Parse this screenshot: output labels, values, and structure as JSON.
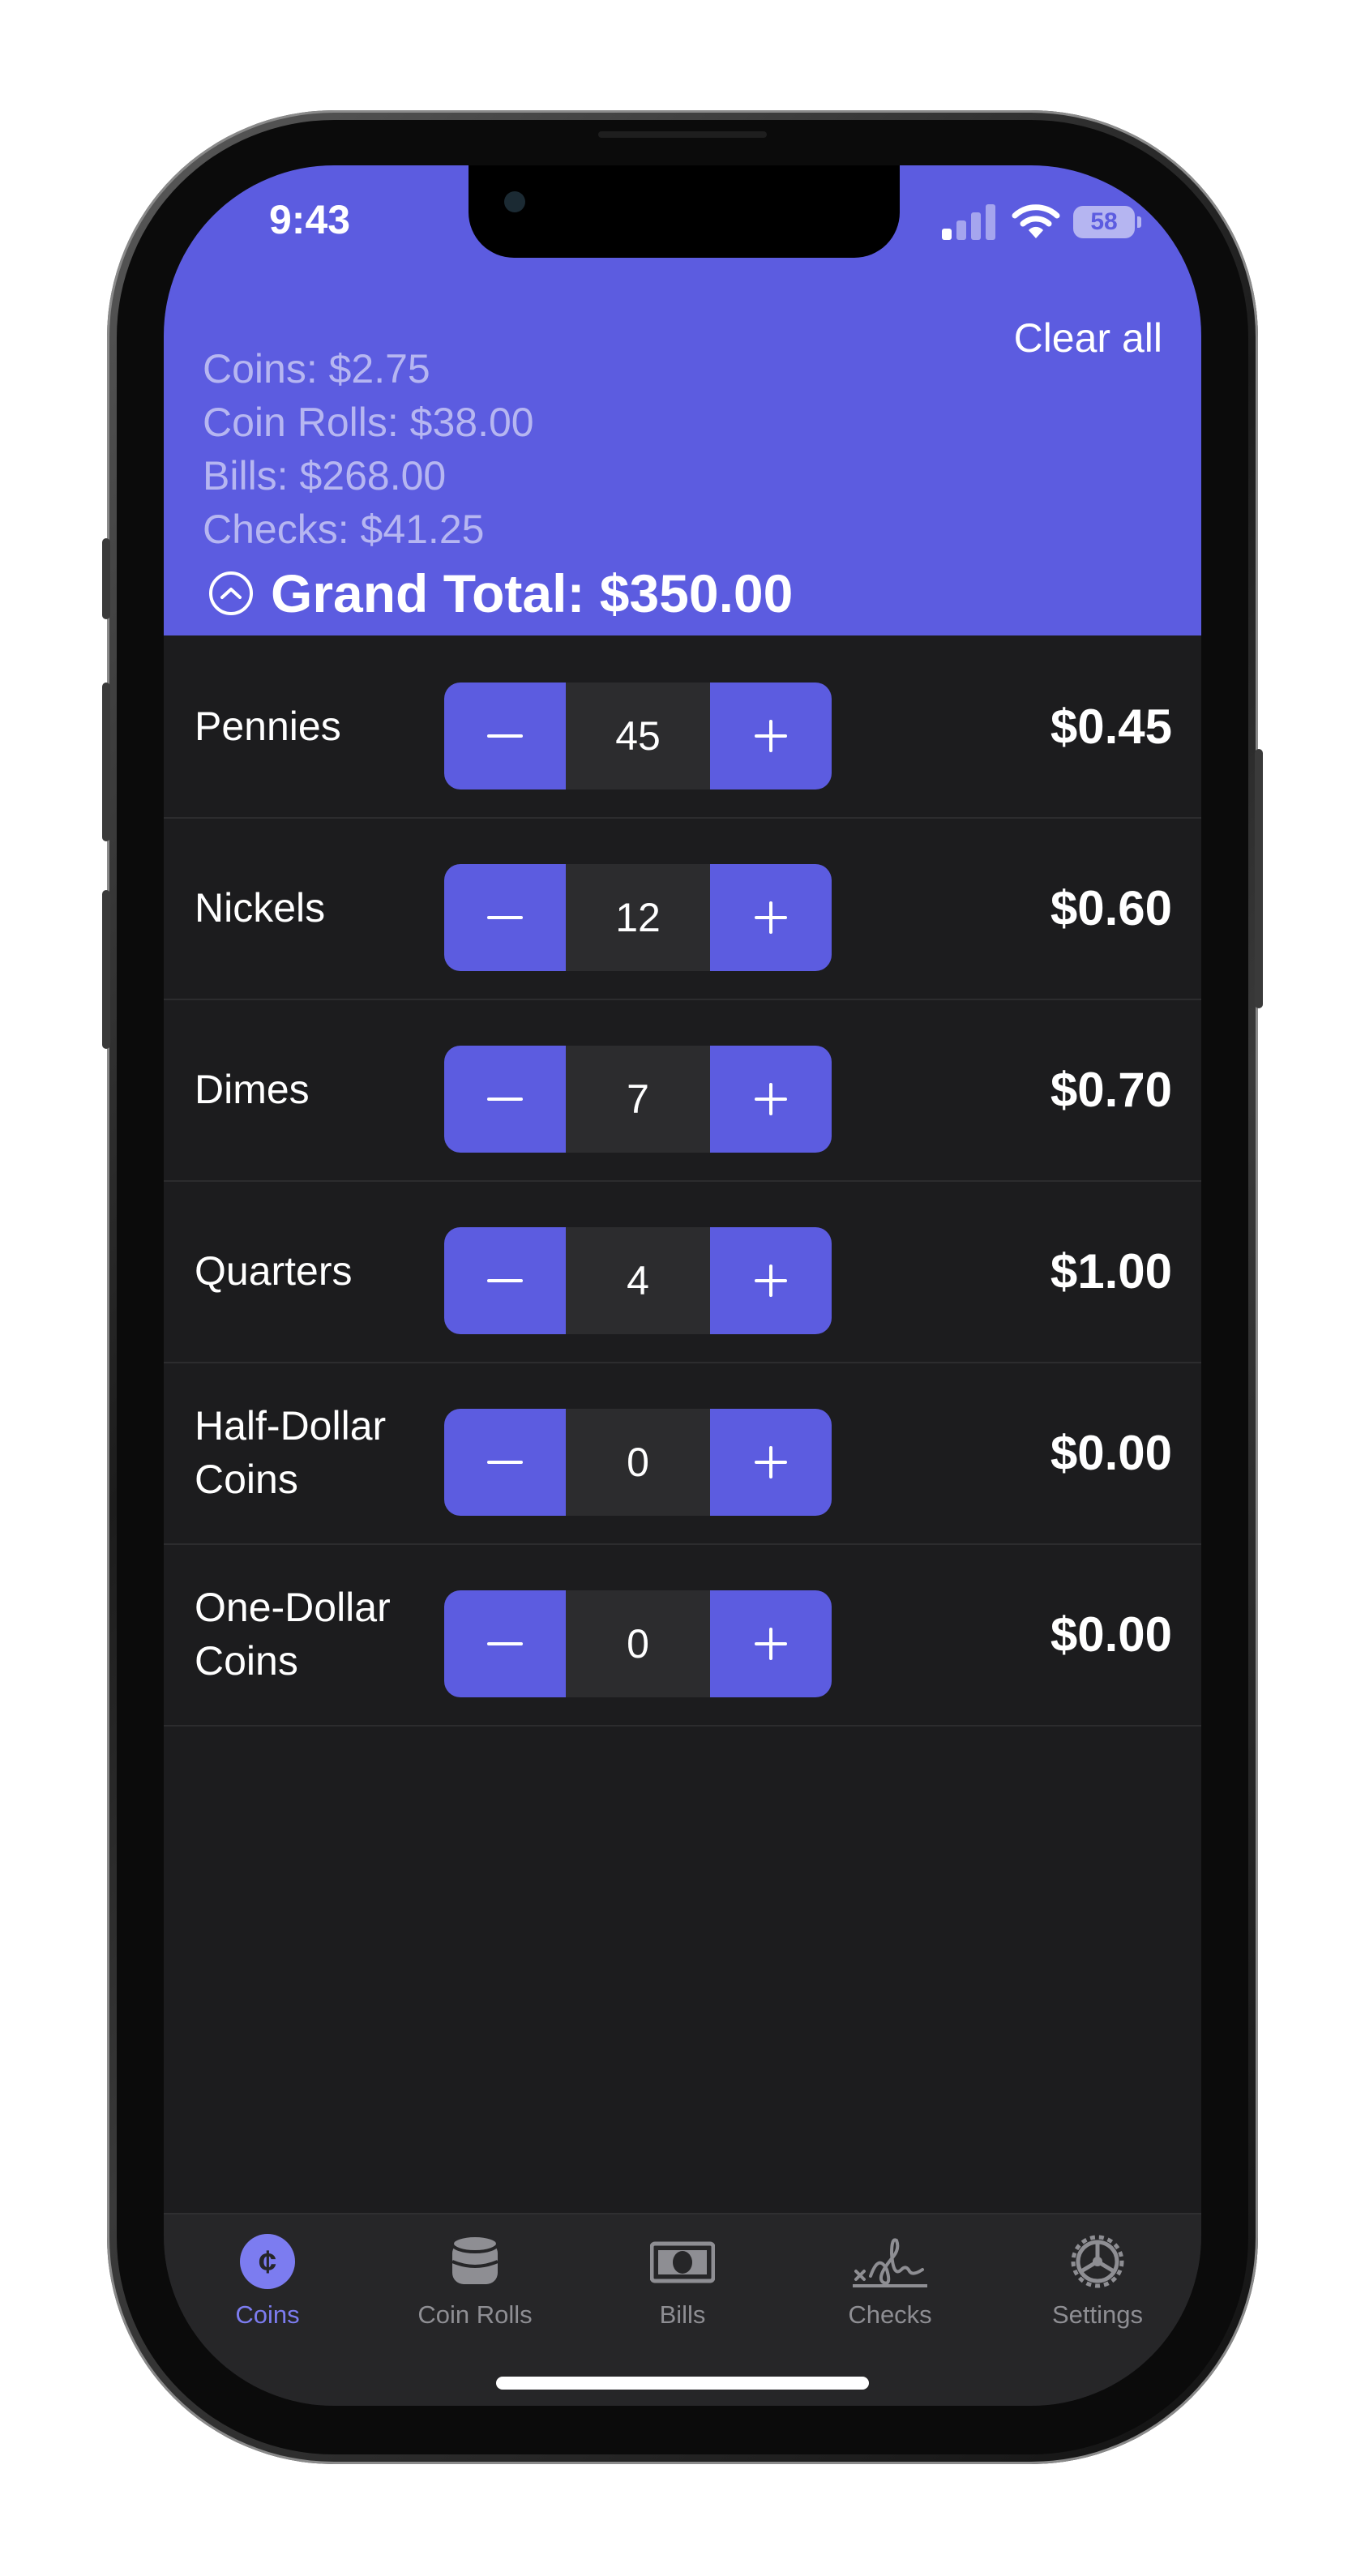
{
  "status_bar": {
    "time": "9:43",
    "battery": "58"
  },
  "header": {
    "clear_all_label": "Clear all",
    "subtotals": [
      "Coins: $2.75",
      "Coin Rolls: $38.00",
      "Bills: $268.00",
      "Checks: $41.25"
    ],
    "grand_total": "Grand Total: $350.00",
    "collapse_icon": "chevron-up-circle-icon"
  },
  "rows": [
    {
      "label": "Pennies",
      "count": "45",
      "value": "$0.45"
    },
    {
      "label": "Nickels",
      "count": "12",
      "value": "$0.60"
    },
    {
      "label": "Dimes",
      "count": "7",
      "value": "$0.70"
    },
    {
      "label": "Quarters",
      "count": "4",
      "value": "$1.00"
    },
    {
      "label": "Half-Dollar Coins",
      "count": "0",
      "value": "$0.00"
    },
    {
      "label": "One-Dollar Coins",
      "count": "0",
      "value": "$0.00"
    }
  ],
  "tabs": [
    {
      "label": "Coins",
      "icon": "cent-coin-icon",
      "active": true
    },
    {
      "label": "Coin Rolls",
      "icon": "coin-stack-icon",
      "active": false
    },
    {
      "label": "Bills",
      "icon": "banknote-icon",
      "active": false
    },
    {
      "label": "Checks",
      "icon": "signature-icon",
      "active": false
    },
    {
      "label": "Settings",
      "icon": "gear-icon",
      "active": false
    }
  ],
  "colors": {
    "accent": "#5C5CE0",
    "background": "#1C1C1E",
    "stepper_value_bg": "#2C2C2E",
    "subtotal_text": "#B6B6F1",
    "tab_inactive": "#8E8E93"
  }
}
